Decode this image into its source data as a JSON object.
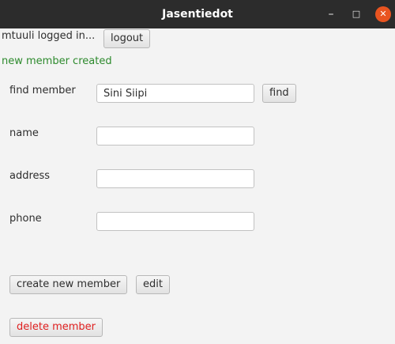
{
  "window": {
    "title": "Jasentiedot",
    "minimize_glyph": "–",
    "maximize_glyph": "□",
    "close_glyph": "✕"
  },
  "session": {
    "user_text": "mtuuli logged in...",
    "logout_label": "logout"
  },
  "status_message": "new member created",
  "form": {
    "find_label": "find member",
    "find_value": "Sini Siipi",
    "find_button": "find",
    "name_label": "name",
    "name_value": "",
    "address_label": "address",
    "address_value": "",
    "phone_label": "phone",
    "phone_value": ""
  },
  "actions": {
    "create_label": "create new member",
    "edit_label": "edit",
    "delete_label": "delete member"
  },
  "colors": {
    "status": "#2d8a2d",
    "delete_text": "#e02020",
    "titlebar": "#2c2c2c",
    "close_button": "#e95420"
  }
}
